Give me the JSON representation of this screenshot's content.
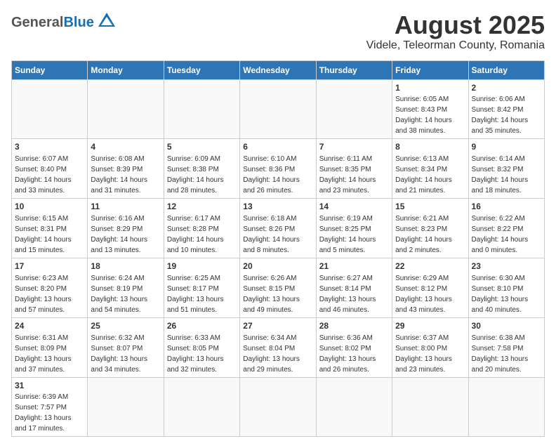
{
  "header": {
    "logo_general": "General",
    "logo_blue": "Blue",
    "month_title": "August 2025",
    "location": "Videle, Teleorman County, Romania"
  },
  "weekdays": [
    "Sunday",
    "Monday",
    "Tuesday",
    "Wednesday",
    "Thursday",
    "Friday",
    "Saturday"
  ],
  "weeks": [
    [
      {
        "day": "",
        "info": ""
      },
      {
        "day": "",
        "info": ""
      },
      {
        "day": "",
        "info": ""
      },
      {
        "day": "",
        "info": ""
      },
      {
        "day": "",
        "info": ""
      },
      {
        "day": "1",
        "info": "Sunrise: 6:05 AM\nSunset: 8:43 PM\nDaylight: 14 hours and 38 minutes."
      },
      {
        "day": "2",
        "info": "Sunrise: 6:06 AM\nSunset: 8:42 PM\nDaylight: 14 hours and 35 minutes."
      }
    ],
    [
      {
        "day": "3",
        "info": "Sunrise: 6:07 AM\nSunset: 8:40 PM\nDaylight: 14 hours and 33 minutes."
      },
      {
        "day": "4",
        "info": "Sunrise: 6:08 AM\nSunset: 8:39 PM\nDaylight: 14 hours and 31 minutes."
      },
      {
        "day": "5",
        "info": "Sunrise: 6:09 AM\nSunset: 8:38 PM\nDaylight: 14 hours and 28 minutes."
      },
      {
        "day": "6",
        "info": "Sunrise: 6:10 AM\nSunset: 8:36 PM\nDaylight: 14 hours and 26 minutes."
      },
      {
        "day": "7",
        "info": "Sunrise: 6:11 AM\nSunset: 8:35 PM\nDaylight: 14 hours and 23 minutes."
      },
      {
        "day": "8",
        "info": "Sunrise: 6:13 AM\nSunset: 8:34 PM\nDaylight: 14 hours and 21 minutes."
      },
      {
        "day": "9",
        "info": "Sunrise: 6:14 AM\nSunset: 8:32 PM\nDaylight: 14 hours and 18 minutes."
      }
    ],
    [
      {
        "day": "10",
        "info": "Sunrise: 6:15 AM\nSunset: 8:31 PM\nDaylight: 14 hours and 15 minutes."
      },
      {
        "day": "11",
        "info": "Sunrise: 6:16 AM\nSunset: 8:29 PM\nDaylight: 14 hours and 13 minutes."
      },
      {
        "day": "12",
        "info": "Sunrise: 6:17 AM\nSunset: 8:28 PM\nDaylight: 14 hours and 10 minutes."
      },
      {
        "day": "13",
        "info": "Sunrise: 6:18 AM\nSunset: 8:26 PM\nDaylight: 14 hours and 8 minutes."
      },
      {
        "day": "14",
        "info": "Sunrise: 6:19 AM\nSunset: 8:25 PM\nDaylight: 14 hours and 5 minutes."
      },
      {
        "day": "15",
        "info": "Sunrise: 6:21 AM\nSunset: 8:23 PM\nDaylight: 14 hours and 2 minutes."
      },
      {
        "day": "16",
        "info": "Sunrise: 6:22 AM\nSunset: 8:22 PM\nDaylight: 14 hours and 0 minutes."
      }
    ],
    [
      {
        "day": "17",
        "info": "Sunrise: 6:23 AM\nSunset: 8:20 PM\nDaylight: 13 hours and 57 minutes."
      },
      {
        "day": "18",
        "info": "Sunrise: 6:24 AM\nSunset: 8:19 PM\nDaylight: 13 hours and 54 minutes."
      },
      {
        "day": "19",
        "info": "Sunrise: 6:25 AM\nSunset: 8:17 PM\nDaylight: 13 hours and 51 minutes."
      },
      {
        "day": "20",
        "info": "Sunrise: 6:26 AM\nSunset: 8:15 PM\nDaylight: 13 hours and 49 minutes."
      },
      {
        "day": "21",
        "info": "Sunrise: 6:27 AM\nSunset: 8:14 PM\nDaylight: 13 hours and 46 minutes."
      },
      {
        "day": "22",
        "info": "Sunrise: 6:29 AM\nSunset: 8:12 PM\nDaylight: 13 hours and 43 minutes."
      },
      {
        "day": "23",
        "info": "Sunrise: 6:30 AM\nSunset: 8:10 PM\nDaylight: 13 hours and 40 minutes."
      }
    ],
    [
      {
        "day": "24",
        "info": "Sunrise: 6:31 AM\nSunset: 8:09 PM\nDaylight: 13 hours and 37 minutes."
      },
      {
        "day": "25",
        "info": "Sunrise: 6:32 AM\nSunset: 8:07 PM\nDaylight: 13 hours and 34 minutes."
      },
      {
        "day": "26",
        "info": "Sunrise: 6:33 AM\nSunset: 8:05 PM\nDaylight: 13 hours and 32 minutes."
      },
      {
        "day": "27",
        "info": "Sunrise: 6:34 AM\nSunset: 8:04 PM\nDaylight: 13 hours and 29 minutes."
      },
      {
        "day": "28",
        "info": "Sunrise: 6:36 AM\nSunset: 8:02 PM\nDaylight: 13 hours and 26 minutes."
      },
      {
        "day": "29",
        "info": "Sunrise: 6:37 AM\nSunset: 8:00 PM\nDaylight: 13 hours and 23 minutes."
      },
      {
        "day": "30",
        "info": "Sunrise: 6:38 AM\nSunset: 7:58 PM\nDaylight: 13 hours and 20 minutes."
      }
    ],
    [
      {
        "day": "31",
        "info": "Sunrise: 6:39 AM\nSunset: 7:57 PM\nDaylight: 13 hours and 17 minutes."
      },
      {
        "day": "",
        "info": ""
      },
      {
        "day": "",
        "info": ""
      },
      {
        "day": "",
        "info": ""
      },
      {
        "day": "",
        "info": ""
      },
      {
        "day": "",
        "info": ""
      },
      {
        "day": "",
        "info": ""
      }
    ]
  ]
}
